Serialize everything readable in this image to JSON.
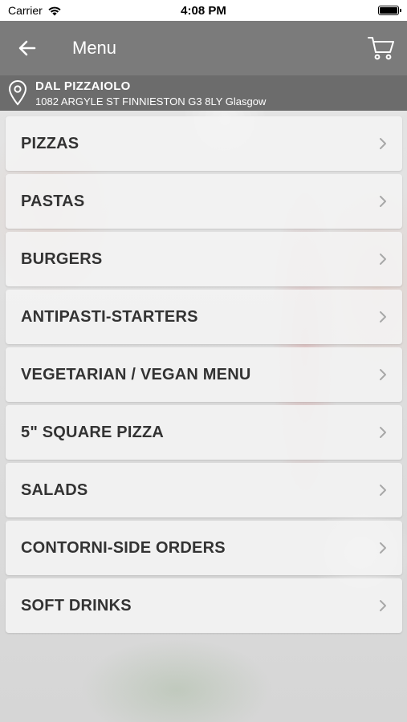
{
  "status_bar": {
    "carrier": "Carrier",
    "time": "4:08 PM"
  },
  "header": {
    "title": "Menu",
    "back_icon": "arrow-left-icon",
    "cart_icon": "cart-icon"
  },
  "location": {
    "name": "DAL PIZZAIOLO",
    "address": "1082 ARGYLE ST FINNIESTON G3 8LY Glasgow",
    "icon": "map-pin-icon"
  },
  "menu": {
    "items": [
      {
        "label": "PIZZAS"
      },
      {
        "label": "PASTAS"
      },
      {
        "label": "BURGERS"
      },
      {
        "label": "ANTIPASTI-STARTERS"
      },
      {
        "label": "VEGETARIAN / VEGAN MENU"
      },
      {
        "label": "5\" SQUARE PIZZA"
      },
      {
        "label": "SALADS"
      },
      {
        "label": "CONTORNI-SIDE ORDERS"
      },
      {
        "label": "SOFT DRINKS"
      }
    ]
  },
  "colors": {
    "navbar": "#7b7b7b",
    "location_bar": "#6c6c6c",
    "item_text": "#333333"
  }
}
